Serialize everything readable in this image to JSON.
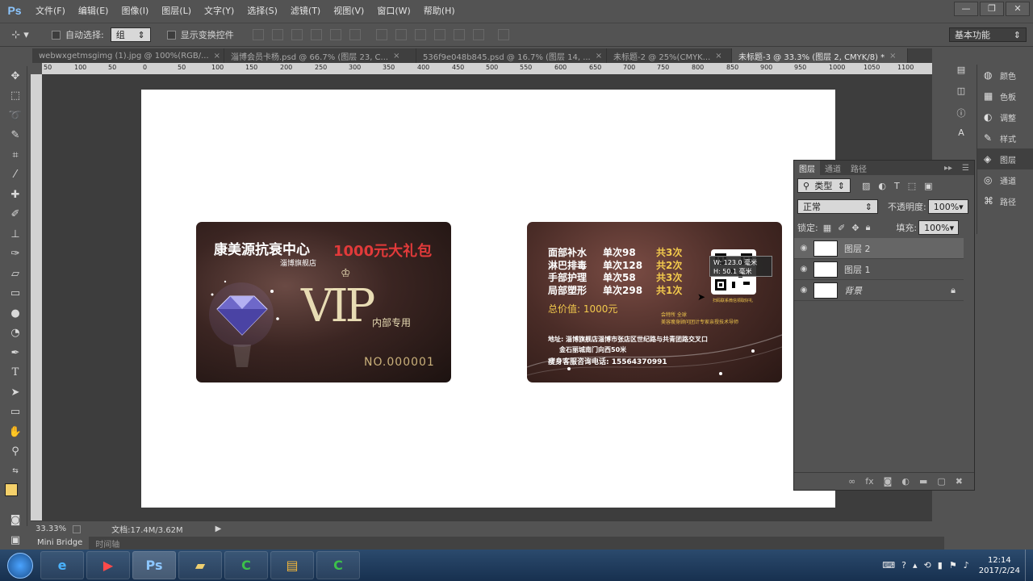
{
  "app": {
    "logo": "Ps"
  },
  "menu": [
    "文件(F)",
    "编辑(E)",
    "图像(I)",
    "图层(L)",
    "文字(Y)",
    "选择(S)",
    "滤镜(T)",
    "视图(V)",
    "窗口(W)",
    "帮助(H)"
  ],
  "window_controls": {
    "minimize": "—",
    "restore": "❐",
    "close": "✕"
  },
  "options": {
    "auto_select_label": "自动选择:",
    "auto_select_value": "组",
    "show_transform_label": "显示变换控件",
    "workspace": "基本功能"
  },
  "tabs": [
    {
      "label": "webwxgetmsgimg (1).jpg @ 100%(RGB/...",
      "active": false
    },
    {
      "label": "淄博会员卡杨.psd @ 66.7% (图层 23, C...",
      "active": false
    },
    {
      "label": "536f9e048b845.psd @ 16.7% (图层 14, ...",
      "active": false
    },
    {
      "label": "未标题-2 @ 25%(CMYK...",
      "active": false
    },
    {
      "label": "未标题-3 @ 33.3% (图层 2, CMYK/8) *",
      "active": true
    }
  ],
  "ruler": {
    "ticks": [
      "50",
      "100",
      "50",
      "0",
      "50",
      "100",
      "150",
      "200",
      "250",
      "300",
      "350",
      "400",
      "450",
      "500",
      "550",
      "600",
      "650",
      "700",
      "750",
      "800",
      "850",
      "900",
      "950",
      "1000",
      "1050",
      "1100"
    ]
  },
  "card_front": {
    "title": "康美源抗衰中心",
    "gift": "1000元大礼包",
    "store": "淄博旗舰店",
    "vip": "VIP",
    "internal": "内部专用",
    "number": "NO.000001"
  },
  "card_back": {
    "services": [
      {
        "name": "面部补水",
        "price": "单次98",
        "count": "共3次"
      },
      {
        "name": "淋巴排毒",
        "price": "单次128",
        "count": "共2次"
      },
      {
        "name": "手部护理",
        "price": "单次58",
        "count": "共3次"
      },
      {
        "name": "局部塑形",
        "price": "单次298",
        "count": "共1次"
      }
    ],
    "total": "总价值: 1000元",
    "tooltip_w": "W: 123.0 毫米",
    "tooltip_h": "H: 50.1 毫米",
    "small_note_1": "会特所 全球",
    "small_note_2": "美容瘦身顾问团计专家亲授技术导师",
    "qr_caption": "扫码联系微信领取好礼",
    "address": "地址: 淄博旗舰店淄博市张店区世纪路与共青团路交叉口",
    "address2": "金石丽城南门向西50米",
    "phone": "瘦身客服咨询电话: 15564370991"
  },
  "status": {
    "zoom": "33.33%",
    "doc": "文档:17.4M/3.62M"
  },
  "bridge": {
    "mini": "Mini Bridge",
    "timeline": "时间轴"
  },
  "panel_col": [
    {
      "icon": "palette-icon",
      "label": "颜色"
    },
    {
      "icon": "swatches-icon",
      "label": "色板"
    },
    {
      "icon": "adjust-icon",
      "label": "调整"
    },
    {
      "icon": "styles-icon",
      "label": "样式"
    },
    {
      "icon": "layers-icon",
      "label": "图层"
    },
    {
      "icon": "channels-icon",
      "label": "通道"
    },
    {
      "icon": "paths-icon",
      "label": "路径"
    }
  ],
  "layers_panel": {
    "tabs": [
      "图层",
      "通道",
      "路径"
    ],
    "filter": "类型",
    "blend": "正常",
    "opacity_label": "不透明度:",
    "opacity": "100%",
    "lock_label": "锁定:",
    "fill_label": "填充:",
    "fill": "100%",
    "layers": [
      {
        "name": "图层 2",
        "selected": true
      },
      {
        "name": "图层 1",
        "selected": false
      },
      {
        "name": "背景",
        "selected": false
      }
    ]
  },
  "taskbar": {
    "time": "12:14",
    "date": "2017/2/24"
  }
}
